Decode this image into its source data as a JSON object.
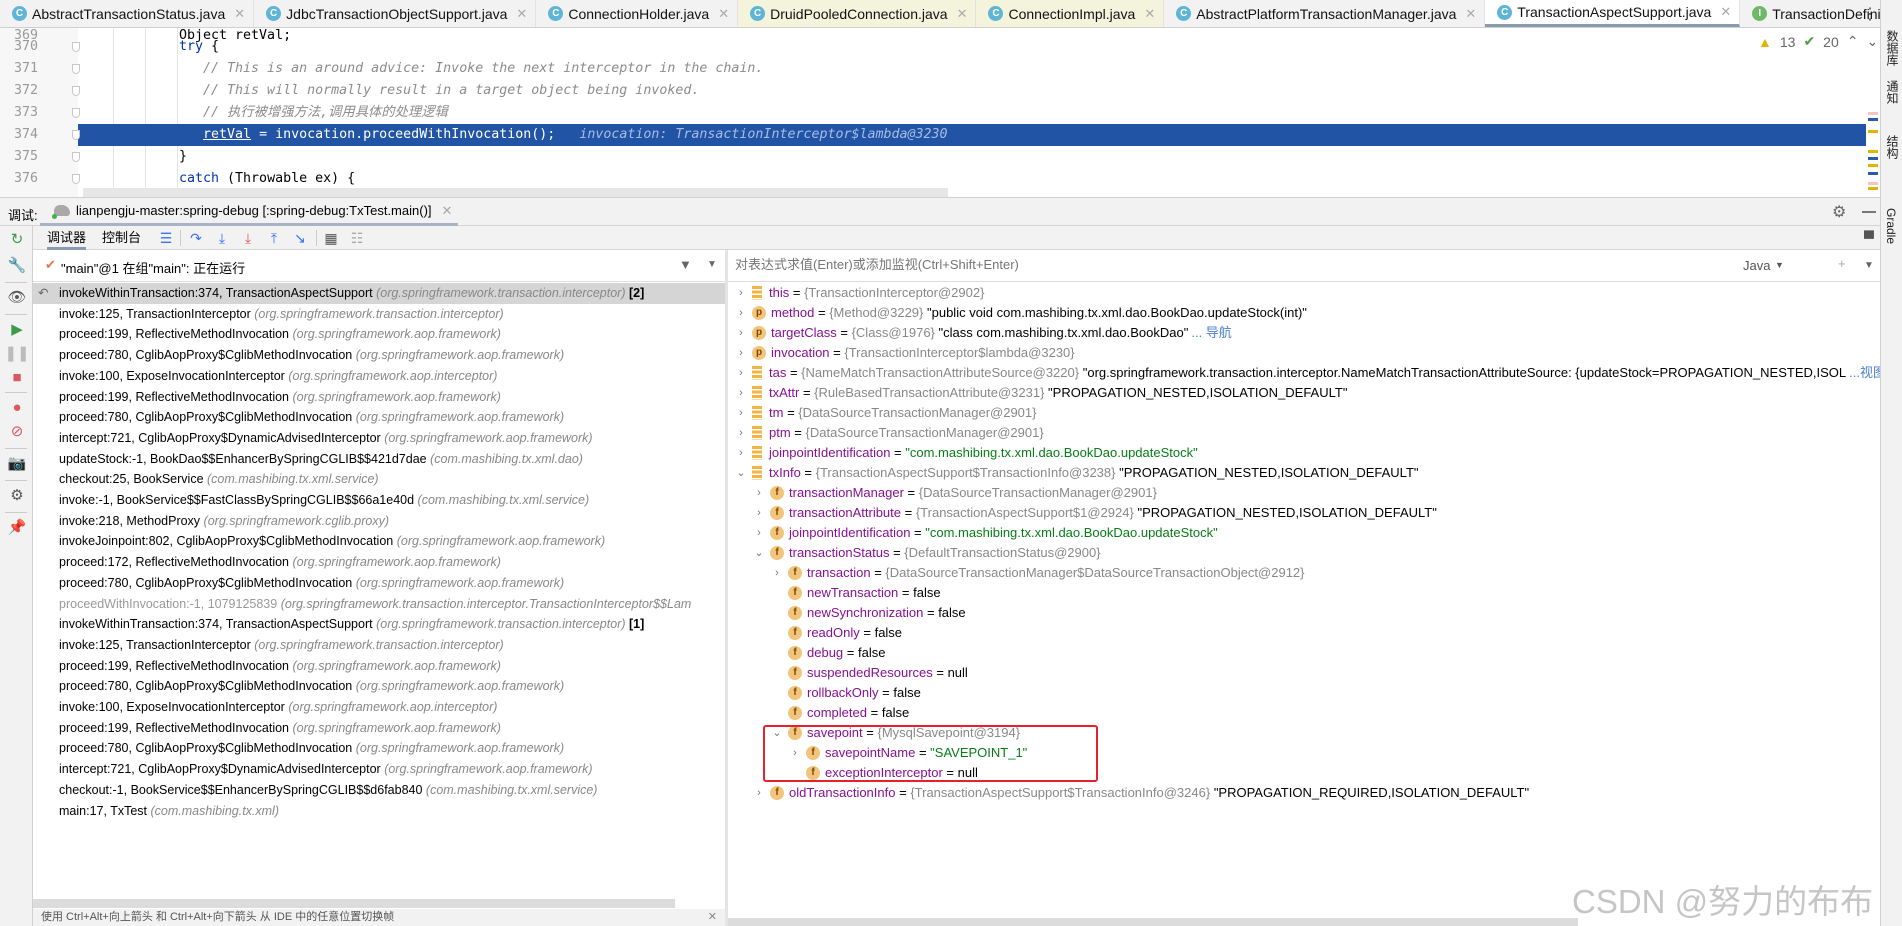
{
  "editor_tabs": [
    {
      "label": "AbstractTransactionStatus.java",
      "icon": "C",
      "state": ""
    },
    {
      "label": "JdbcTransactionObjectSupport.java",
      "icon": "C",
      "state": ""
    },
    {
      "label": "ConnectionHolder.java",
      "icon": "C",
      "state": ""
    },
    {
      "label": "DruidPooledConnection.java",
      "icon": "C",
      "state": "yellow"
    },
    {
      "label": "ConnectionImpl.java",
      "icon": "C",
      "state": "yellow"
    },
    {
      "label": "AbstractPlatformTransactionManager.java",
      "icon": "C",
      "state": ""
    },
    {
      "label": "TransactionAspectSupport.java",
      "icon": "C",
      "state": "active"
    },
    {
      "label": "TransactionDefinition.java",
      "icon": "I",
      "state": ""
    }
  ],
  "editor": {
    "inspections": {
      "warnings": "13",
      "ok": "20"
    },
    "lines": [
      {
        "num": "369",
        "segments": [
          {
            "t": "Object retVal;",
            "s": "plain"
          }
        ]
      },
      {
        "num": "370",
        "segments": [
          {
            "t": "try",
            "s": "keyword"
          },
          {
            "t": " {",
            "s": "plain"
          }
        ]
      },
      {
        "num": "371",
        "segments": [
          {
            "t": "   // This is an around advice: Invoke the next interceptor in the chain.",
            "s": "comment"
          }
        ]
      },
      {
        "num": "372",
        "segments": [
          {
            "t": "   // This will normally result in a target object being invoked.",
            "s": "comment"
          }
        ]
      },
      {
        "num": "373",
        "segments": [
          {
            "t": "   // 执行被增强方法,调用具体的处理逻辑",
            "s": "comment"
          }
        ]
      },
      {
        "num": "374",
        "highlight": true,
        "segments": [
          {
            "t": "   ",
            "s": "plain"
          },
          {
            "t": "retVal",
            "s": "var"
          },
          {
            "t": " = invocation.proceedWithInvocation();   ",
            "s": "plain"
          },
          {
            "t": "invocation: TransactionInterceptor$lambda@3230",
            "s": "hint"
          }
        ]
      },
      {
        "num": "375",
        "segments": [
          {
            "t": "}",
            "s": "plain"
          }
        ]
      },
      {
        "num": "376",
        "segments": [
          {
            "t": "catch",
            "s": "keyword"
          },
          {
            "t": " (Throwable ex) {",
            "s": "plain"
          }
        ]
      }
    ]
  },
  "debug": {
    "title": "调试:",
    "session": "lianpengju-master:spring-debug [:spring-debug:TxTest.main()]",
    "tabs": {
      "debugger": "调试器",
      "console": "控制台"
    },
    "thread": "\"main\"@1 在组\"main\": 正在运行",
    "eval_placeholder": "对表达式求值(Enter)或添加监视(Ctrl+Shift+Enter)",
    "language": "Java",
    "status_hint": "使用 Ctrl+Alt+向上箭头 和 Ctrl+Alt+向下箭头 从 IDE 中的任意位置切换帧"
  },
  "frames": [
    {
      "m": "invokeWithinTransaction:374, TransactionAspectSupport",
      "p": "(org.springframework.transaction.interceptor)",
      "mark": "[2]",
      "sel": true
    },
    {
      "m": "invoke:125, TransactionInterceptor",
      "p": "(org.springframework.transaction.interceptor)"
    },
    {
      "m": "proceed:199, ReflectiveMethodInvocation",
      "p": "(org.springframework.aop.framework)"
    },
    {
      "m": "proceed:780, CglibAopProxy$CglibMethodInvocation",
      "p": "(org.springframework.aop.framework)"
    },
    {
      "m": "invoke:100, ExposeInvocationInterceptor",
      "p": "(org.springframework.aop.interceptor)"
    },
    {
      "m": "proceed:199, ReflectiveMethodInvocation",
      "p": "(org.springframework.aop.framework)"
    },
    {
      "m": "proceed:780, CglibAopProxy$CglibMethodInvocation",
      "p": "(org.springframework.aop.framework)"
    },
    {
      "m": "intercept:721, CglibAopProxy$DynamicAdvisedInterceptor",
      "p": "(org.springframework.aop.framework)"
    },
    {
      "m": "updateStock:-1, BookDao$$EnhancerBySpringCGLIB$$421d7dae",
      "p": "(com.mashibing.tx.xml.dao)"
    },
    {
      "m": "checkout:25, BookService",
      "p": "(com.mashibing.tx.xml.service)"
    },
    {
      "m": "invoke:-1, BookService$$FastClassBySpringCGLIB$$66a1e40d",
      "p": "(com.mashibing.tx.xml.service)"
    },
    {
      "m": "invoke:218, MethodProxy",
      "p": "(org.springframework.cglib.proxy)"
    },
    {
      "m": "invokeJoinpoint:802, CglibAopProxy$CglibMethodInvocation",
      "p": "(org.springframework.aop.framework)"
    },
    {
      "m": "proceed:172, ReflectiveMethodInvocation",
      "p": "(org.springframework.aop.framework)"
    },
    {
      "m": "proceed:780, CglibAopProxy$CglibMethodInvocation",
      "p": "(org.springframework.aop.framework)"
    },
    {
      "m": "proceedWithInvocation:-1, 1079125839",
      "p": "(org.springframework.transaction.interceptor.TransactionInterceptor$$Lam",
      "dim": true
    },
    {
      "m": "invokeWithinTransaction:374, TransactionAspectSupport",
      "p": "(org.springframework.transaction.interceptor)",
      "mark": "[1]"
    },
    {
      "m": "invoke:125, TransactionInterceptor",
      "p": "(org.springframework.transaction.interceptor)"
    },
    {
      "m": "proceed:199, ReflectiveMethodInvocation",
      "p": "(org.springframework.aop.framework)"
    },
    {
      "m": "proceed:780, CglibAopProxy$CglibMethodInvocation",
      "p": "(org.springframework.aop.framework)"
    },
    {
      "m": "invoke:100, ExposeInvocationInterceptor",
      "p": "(org.springframework.aop.interceptor)"
    },
    {
      "m": "proceed:199, ReflectiveMethodInvocation",
      "p": "(org.springframework.aop.framework)"
    },
    {
      "m": "proceed:780, CglibAopProxy$CglibMethodInvocation",
      "p": "(org.springframework.aop.framework)"
    },
    {
      "m": "intercept:721, CglibAopProxy$DynamicAdvisedInterceptor",
      "p": "(org.springframework.aop.framework)"
    },
    {
      "m": "checkout:-1, BookService$$EnhancerBySpringCGLIB$$d6fab840",
      "p": "(com.mashibing.tx.xml.service)"
    },
    {
      "m": "main:17, TxTest",
      "p": "(com.mashibing.tx.xml)"
    }
  ],
  "variables": [
    {
      "level": 0,
      "exp": "collapsed",
      "icon": "local",
      "name": "this",
      "type": "{TransactionInterceptor@2902}"
    },
    {
      "level": 0,
      "exp": "collapsed",
      "icon": "param",
      "name": "method",
      "type": "{Method@3229}",
      "value": "\"public void com.mashibing.tx.xml.dao.BookDao.updateStock(int)\""
    },
    {
      "level": 0,
      "exp": "collapsed",
      "icon": "param",
      "name": "targetClass",
      "type": "{Class@1976}",
      "value": "\"class com.mashibing.tx.xml.dao.BookDao\"",
      "link": "... 导航"
    },
    {
      "level": 0,
      "exp": "collapsed",
      "icon": "param",
      "name": "invocation",
      "type": "{TransactionInterceptor$lambda@3230}"
    },
    {
      "level": 0,
      "exp": "collapsed",
      "icon": "local",
      "name": "tas",
      "type": "{NameMatchTransactionAttributeSource@3220}",
      "value": "\"org.springframework.transaction.interceptor.NameMatchTransactionAttributeSource: {updateStock=PROPAGATION_NESTED,ISOL",
      "link": "...视图"
    },
    {
      "level": 0,
      "exp": "collapsed",
      "icon": "local",
      "name": "txAttr",
      "type": "{RuleBasedTransactionAttribute@3231}",
      "value": "\"PROPAGATION_NESTED,ISOLATION_DEFAULT\""
    },
    {
      "level": 0,
      "exp": "collapsed",
      "icon": "local",
      "name": "tm",
      "type": "{DataSourceTransactionManager@2901}"
    },
    {
      "level": 0,
      "exp": "collapsed",
      "icon": "local",
      "name": "ptm",
      "type": "{DataSourceTransactionManager@2901}"
    },
    {
      "level": 0,
      "exp": "collapsed",
      "icon": "local",
      "name": "joinpointIdentification",
      "value": "\"com.mashibing.tx.xml.dao.BookDao.updateStock\"",
      "green": true
    },
    {
      "level": 0,
      "exp": "expanded",
      "icon": "local",
      "name": "txInfo",
      "type": "{TransactionAspectSupport$TransactionInfo@3238}",
      "value": "\"PROPAGATION_NESTED,ISOLATION_DEFAULT\""
    },
    {
      "level": 1,
      "exp": "collapsed",
      "icon": "field",
      "name": "transactionManager",
      "type": "{DataSourceTransactionManager@2901}"
    },
    {
      "level": 1,
      "exp": "collapsed",
      "icon": "field",
      "name": "transactionAttribute",
      "type": "{TransactionAspectSupport$1@2924}",
      "value": "\"PROPAGATION_NESTED,ISOLATION_DEFAULT\""
    },
    {
      "level": 1,
      "exp": "collapsed",
      "icon": "field",
      "name": "joinpointIdentification",
      "value": "\"com.mashibing.tx.xml.dao.BookDao.updateStock\"",
      "green": true
    },
    {
      "level": 1,
      "exp": "expanded",
      "icon": "field",
      "name": "transactionStatus",
      "type": "{DefaultTransactionStatus@2900}"
    },
    {
      "level": 2,
      "exp": "collapsed",
      "icon": "field",
      "name": "transaction",
      "type": "{DataSourceTransactionManager$DataSourceTransactionObject@2912}"
    },
    {
      "level": 2,
      "exp": "none",
      "icon": "field",
      "name": "newTransaction",
      "value": "false"
    },
    {
      "level": 2,
      "exp": "none",
      "icon": "field",
      "name": "newSynchronization",
      "value": "false"
    },
    {
      "level": 2,
      "exp": "none",
      "icon": "field",
      "name": "readOnly",
      "value": "false"
    },
    {
      "level": 2,
      "exp": "none",
      "icon": "field",
      "name": "debug",
      "value": "false"
    },
    {
      "level": 2,
      "exp": "none",
      "icon": "field",
      "name": "suspendedResources",
      "value": "null"
    },
    {
      "level": 2,
      "exp": "none",
      "icon": "field",
      "name": "rollbackOnly",
      "value": "false"
    },
    {
      "level": 2,
      "exp": "none",
      "icon": "field",
      "name": "completed",
      "value": "false"
    },
    {
      "level": 2,
      "exp": "expanded",
      "icon": "field",
      "name": "savepoint",
      "type": "{MysqlSavepoint@3194}"
    },
    {
      "level": 3,
      "exp": "collapsed",
      "icon": "field",
      "name": "savepointName",
      "value": "\"SAVEPOINT_1\"",
      "green": true
    },
    {
      "level": 3,
      "exp": "none",
      "icon": "field",
      "name": "exceptionInterceptor",
      "value": "null"
    },
    {
      "level": 1,
      "exp": "collapsed",
      "icon": "field",
      "name": "oldTransactionInfo",
      "type": "{TransactionAspectSupport$TransactionInfo@3246}",
      "value": "\"PROPAGATION_REQUIRED,ISOLATION_DEFAULT\""
    }
  ],
  "right_sidebar": [
    "数据库",
    "通知",
    "结构",
    "Gradle"
  ],
  "watermark": "CSDN @努力的布布",
  "colors": {
    "highlight": "#2154a5",
    "annotation_box": "#e8202a",
    "string_green": "#067d17",
    "link": "#4b7fd0"
  }
}
